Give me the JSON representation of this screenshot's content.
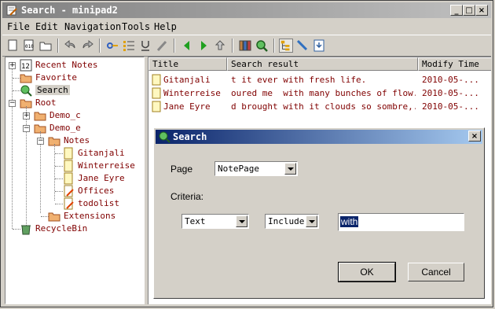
{
  "window": {
    "title": "Search - minipad2"
  },
  "menu": [
    "File",
    "Edit",
    "Navigation",
    "Tools",
    "Help"
  ],
  "tree": {
    "recent_notes": "Recent Notes",
    "favorite": "Favorite",
    "search": "Search",
    "root": "Root",
    "demo_c": "Demo_c",
    "demo_e": "Demo_e",
    "notes": "Notes",
    "gitanjali": "Gitanjali",
    "winterreise": "Winterreise",
    "jane_eyre": "Jane Eyre",
    "offices": "Offices",
    "todolist": "todolist",
    "extensions": "Extensions",
    "recyclebin": "RecycleBin"
  },
  "list": {
    "columns": [
      "Title",
      "Search result",
      "Modify Time"
    ],
    "rows": [
      {
        "title": "Gitanjali",
        "result": "t it ever with fresh life.          ...",
        "time": "2010-05-..."
      },
      {
        "title": "Winterreise",
        "result": "oured me  with many bunches of flow...",
        "time": "2010-05-..."
      },
      {
        "title": "Jane Eyre",
        "result": "d brought with it clouds so sombre,...",
        "time": "2010-05-..."
      }
    ]
  },
  "dialog": {
    "title": "Search",
    "page_label": "Page",
    "page_value": "NotePage",
    "criteria_label": "Criteria:",
    "field_value": "Text",
    "op_value": "Include",
    "search_text": "with",
    "ok_label": "OK",
    "cancel_label": "Cancel"
  },
  "colors": {
    "accent": "#0a246a",
    "tree_text": "#800000",
    "folder": "#e8a060"
  }
}
